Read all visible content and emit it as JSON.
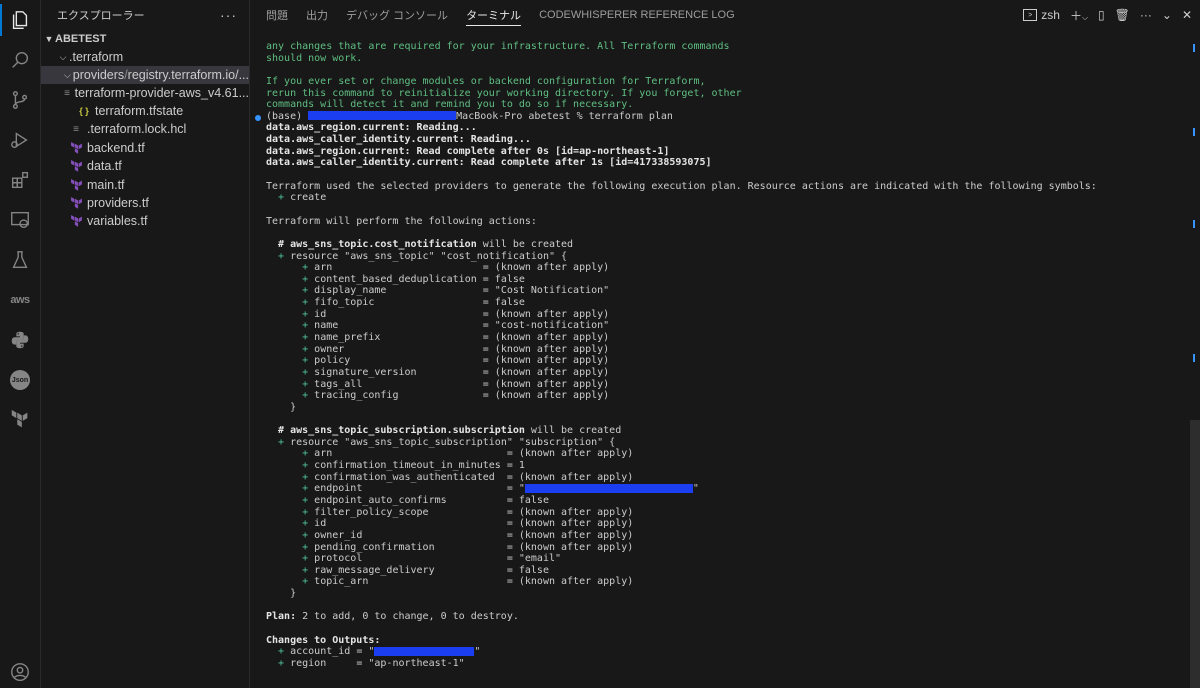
{
  "explorer": {
    "title": "エクスプローラー",
    "more": "···",
    "root": "ABETEST",
    "items": [
      {
        "label": ".terraform",
        "indent": 1,
        "type": "folder-open"
      },
      {
        "label": "providers",
        "suffix": "registry.terraform.io/...",
        "indent": 2,
        "type": "folder-open"
      },
      {
        "label": "terraform-provider-aws_v4.61...",
        "indent": 3,
        "type": "file-lines"
      },
      {
        "label": "terraform.tfstate",
        "indent": 2,
        "type": "json"
      },
      {
        "label": ".terraform.lock.hcl",
        "indent": 1,
        "type": "file-lines"
      },
      {
        "label": "backend.tf",
        "indent": 1,
        "type": "tf"
      },
      {
        "label": "data.tf",
        "indent": 1,
        "type": "tf"
      },
      {
        "label": "main.tf",
        "indent": 1,
        "type": "tf"
      },
      {
        "label": "providers.tf",
        "indent": 1,
        "type": "tf"
      },
      {
        "label": "variables.tf",
        "indent": 1,
        "type": "tf"
      }
    ]
  },
  "panel": {
    "tabs": [
      "問題",
      "出力",
      "デバッグ コンソール",
      "ターミナル",
      "CODEWHISPERER REFERENCE LOG"
    ],
    "active_tab": "ターミナル",
    "shell": "zsh"
  },
  "terminal": {
    "lines": [
      {
        "t": "any changes that are required for your infrastructure. All Terraform commands",
        "s": "green"
      },
      {
        "t": "should now work.",
        "s": "green"
      },
      {
        "t": "",
        "s": ""
      },
      {
        "t": "If you ever set or change modules or backend configuration for Terraform,",
        "s": "green"
      },
      {
        "t": "rerun this command to reinitialize your working directory. If you forget, other",
        "s": "green"
      },
      {
        "t": "commands will detect it and remind you to do so if necessary.",
        "s": "green"
      },
      {
        "t": "MacBook-Pro abetest % terraform plan",
        "s": "prompt",
        "pre": "(base) "
      },
      {
        "t": "data.aws_region.current: Reading...",
        "s": "bold"
      },
      {
        "t": "data.aws_caller_identity.current: Reading...",
        "s": "bold"
      },
      {
        "t": "data.aws_region.current: Read complete after 0s [id=ap-northeast-1]",
        "s": "bold"
      },
      {
        "t": "data.aws_caller_identity.current: Read complete after 1s [id=417338593075]",
        "s": "bold"
      },
      {
        "t": "",
        "s": ""
      },
      {
        "t": "Terraform used the selected providers to generate the following execution plan. Resource actions are indicated with the following symbols:",
        "s": ""
      },
      {
        "t": "  + create",
        "s": "plus"
      },
      {
        "t": "",
        "s": ""
      },
      {
        "t": "Terraform will perform the following actions:",
        "s": ""
      },
      {
        "t": "",
        "s": ""
      },
      {
        "t": "  # aws_sns_topic.cost_notification will be created",
        "s": "comment",
        "b": "# aws_sns_topic.cost_notification",
        "r": " will be created"
      },
      {
        "t": "  + resource \"aws_sns_topic\" \"cost_notification\" {",
        "s": "plus"
      },
      {
        "t": "      + arn                         = (known after apply)",
        "s": "plus"
      },
      {
        "t": "      + content_based_deduplication = false",
        "s": "plus"
      },
      {
        "t": "      + display_name                = \"Cost Notification\"",
        "s": "plus"
      },
      {
        "t": "      + fifo_topic                  = false",
        "s": "plus"
      },
      {
        "t": "      + id                          = (known after apply)",
        "s": "plus"
      },
      {
        "t": "      + name                        = \"cost-notification\"",
        "s": "plus"
      },
      {
        "t": "      + name_prefix                 = (known after apply)",
        "s": "plus"
      },
      {
        "t": "      + owner                       = (known after apply)",
        "s": "plus"
      },
      {
        "t": "      + policy                      = (known after apply)",
        "s": "plus"
      },
      {
        "t": "      + signature_version           = (known after apply)",
        "s": "plus"
      },
      {
        "t": "      + tags_all                    = (known after apply)",
        "s": "plus"
      },
      {
        "t": "      + tracing_config              = (known after apply)",
        "s": "plus"
      },
      {
        "t": "    }",
        "s": ""
      },
      {
        "t": "",
        "s": ""
      },
      {
        "t": "  # aws_sns_topic_subscription.subscription will be created",
        "s": "comment",
        "b": "# aws_sns_topic_subscription.subscription",
        "r": " will be created"
      },
      {
        "t": "  + resource \"aws_sns_topic_subscription\" \"subscription\" {",
        "s": "plus"
      },
      {
        "t": "      + arn                             = (known after apply)",
        "s": "plus"
      },
      {
        "t": "      + confirmation_timeout_in_minutes = 1",
        "s": "plus"
      },
      {
        "t": "      + confirmation_was_authenticated  = (known after apply)",
        "s": "plus"
      },
      {
        "t": "      + endpoint                        = \"",
        "s": "plus",
        "redact": "endpoint"
      },
      {
        "t": "      + endpoint_auto_confirms          = false",
        "s": "plus"
      },
      {
        "t": "      + filter_policy_scope             = (known after apply)",
        "s": "plus"
      },
      {
        "t": "      + id                              = (known after apply)",
        "s": "plus"
      },
      {
        "t": "      + owner_id                        = (known after apply)",
        "s": "plus"
      },
      {
        "t": "      + pending_confirmation            = (known after apply)",
        "s": "plus"
      },
      {
        "t": "      + protocol                        = \"email\"",
        "s": "plus"
      },
      {
        "t": "      + raw_message_delivery            = false",
        "s": "plus"
      },
      {
        "t": "      + topic_arn                       = (known after apply)",
        "s": "plus"
      },
      {
        "t": "    }",
        "s": ""
      },
      {
        "t": "",
        "s": ""
      },
      {
        "t": " 2 to add, 0 to change, 0 to destroy.",
        "s": "plan",
        "b": "Plan:"
      },
      {
        "t": "",
        "s": ""
      },
      {
        "t": "Changes to Outputs:",
        "s": "bold"
      },
      {
        "t": "  + account_id = \"",
        "s": "plus",
        "redact": "account"
      },
      {
        "t": "  + region     = \"ap-northeast-1\"",
        "s": "plus"
      }
    ]
  }
}
